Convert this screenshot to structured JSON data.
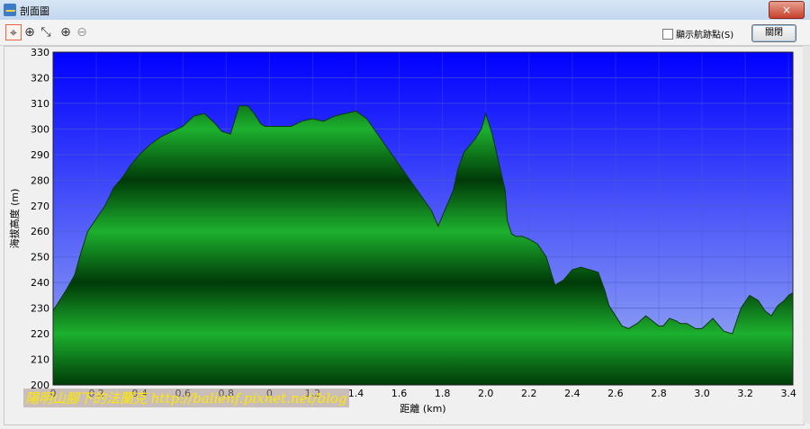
{
  "window": {
    "title": "剖面圖",
    "close_glyph": "×"
  },
  "toolbar": {
    "tools": [
      {
        "name": "select-tool",
        "glyph": "⌖"
      },
      {
        "name": "crosshair-tool",
        "glyph": "⊕"
      },
      {
        "name": "lasso-tool",
        "glyph": "⤡"
      },
      {
        "name": "zoom-in-tool",
        "glyph": "⊕"
      },
      {
        "name": "zoom-out-tool",
        "glyph": "⊖"
      }
    ],
    "show_track_label": "顯示航跡點(S)",
    "close_label": "關閉"
  },
  "watermark": "陽明山腳下的法蘭克 http://balienf.pixnet.net/blog",
  "colors": {
    "plot_top": "#0000ff",
    "plot_bottom": "#9fb4f2",
    "fill_light": "#1db02e",
    "fill_dark": "#003a08",
    "grid": "#4a5ec9"
  },
  "chart_data": {
    "type": "area",
    "xlabel": "距離 (km)",
    "ylabel": "海拔高度 (m)",
    "xlim": [
      0,
      3.42
    ],
    "ylim": [
      200,
      330
    ],
    "xticks": [
      0,
      0.2,
      0.4,
      0.6,
      0.8,
      1.0,
      1.2,
      1.4,
      1.6,
      1.8,
      2.0,
      2.2,
      2.4,
      2.6,
      2.8,
      3.0,
      3.2,
      3.4
    ],
    "xtick_labels": [
      "0",
      "0.2",
      "0.4",
      "0.6",
      "0.8",
      "0",
      "1.2",
      "1.4",
      "1.6",
      "1.8",
      "2.0",
      "2.2",
      "2.4",
      "2.6",
      "2.8",
      "3.0",
      "3.2",
      "3.4"
    ],
    "yticks": [
      200,
      210,
      220,
      230,
      240,
      250,
      260,
      270,
      280,
      290,
      300,
      310,
      320,
      330
    ],
    "grid": true,
    "x": [
      0,
      0.03,
      0.06,
      0.1,
      0.13,
      0.16,
      0.2,
      0.24,
      0.28,
      0.32,
      0.36,
      0.4,
      0.45,
      0.5,
      0.55,
      0.6,
      0.65,
      0.7,
      0.75,
      0.78,
      0.82,
      0.86,
      0.9,
      0.93,
      0.96,
      0.98,
      1.0,
      1.03,
      1.06,
      1.1,
      1.15,
      1.2,
      1.25,
      1.3,
      1.35,
      1.4,
      1.45,
      1.5,
      1.55,
      1.6,
      1.65,
      1.7,
      1.75,
      1.78,
      1.8,
      1.83,
      1.85,
      1.87,
      1.9,
      1.92,
      1.95,
      1.98,
      2.0,
      2.03,
      2.06,
      2.09,
      2.1,
      2.12,
      2.14,
      2.17,
      2.2,
      2.24,
      2.28,
      2.32,
      2.36,
      2.4,
      2.44,
      2.48,
      2.52,
      2.55,
      2.57,
      2.6,
      2.63,
      2.66,
      2.7,
      2.74,
      2.77,
      2.8,
      2.82,
      2.85,
      2.88,
      2.9,
      2.93,
      2.97,
      3.0,
      3.05,
      3.1,
      3.14,
      3.18,
      3.22,
      3.26,
      3.29,
      3.32,
      3.35,
      3.38,
      3.4,
      3.42
    ],
    "y": [
      229,
      233,
      237,
      243,
      252,
      260,
      265,
      270,
      277,
      281,
      286,
      290,
      294,
      297,
      299,
      301,
      305,
      306,
      302,
      299,
      298,
      309,
      309,
      306,
      302,
      301,
      301,
      301,
      301,
      301,
      303,
      304,
      303,
      305,
      306,
      307,
      304,
      298,
      292,
      286,
      280,
      274,
      268,
      262,
      266,
      272,
      276,
      284,
      291,
      293,
      296,
      300,
      306,
      298,
      287,
      276,
      264,
      259,
      258,
      258,
      257,
      255,
      250,
      239,
      241,
      245,
      246,
      245,
      244,
      237,
      231,
      227,
      223,
      222,
      224,
      227,
      225,
      223,
      223,
      226,
      225,
      224,
      224,
      222,
      222,
      226,
      221,
      220,
      230,
      235,
      233,
      229,
      227,
      231,
      233,
      235,
      236
    ]
  }
}
